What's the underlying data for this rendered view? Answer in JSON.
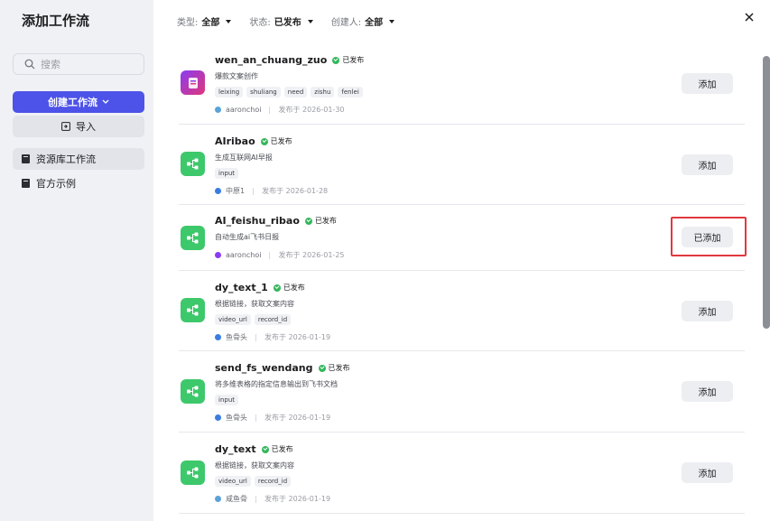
{
  "sidebar": {
    "title": "添加工作流",
    "search_placeholder": "搜索",
    "create_label": "创建工作流",
    "import_label": "导入",
    "nav": [
      {
        "label": "资源库工作流",
        "active": true
      },
      {
        "label": "官方示例",
        "active": false
      }
    ]
  },
  "filters": [
    {
      "label": "类型:",
      "value": "全部"
    },
    {
      "label": "状态:",
      "value": "已发布"
    },
    {
      "label": "创建人:",
      "value": "全部"
    }
  ],
  "status_label": "已发布",
  "workflows": [
    {
      "name": "wen_an_chuang_zuo",
      "desc": "爆款文案创作",
      "tags": [
        "leixing",
        "shuliang",
        "need",
        "zishu",
        "fenlei"
      ],
      "author": "aaronchoi",
      "date": "发布于 2026-01-30",
      "action": "添加",
      "icon": "app-icon"
    },
    {
      "name": "AIribao",
      "desc": "生成互联网AI早报",
      "tags": [
        "input"
      ],
      "author": "中原1",
      "date": "发布于 2026-01-28",
      "action": "添加",
      "icon": "workflow-icon"
    },
    {
      "name": "AI_feishu_ribao",
      "desc": "自动生成ai飞书日报",
      "tags": [],
      "author": "aaronchoi",
      "date": "发布于 2026-01-25",
      "action": "已添加",
      "icon": "workflow-icon"
    },
    {
      "name": "dy_text_1",
      "desc": "根据链接，获取文案内容",
      "tags": [
        "video_url",
        "record_id"
      ],
      "author": "鱼骨头",
      "date": "发布于 2026-01-19",
      "action": "添加",
      "icon": "workflow-icon"
    },
    {
      "name": "send_fs_wendang",
      "desc": "将多维表格的指定信息输出到飞书文档",
      "tags": [
        "input"
      ],
      "author": "鱼骨头",
      "date": "发布于 2026-01-19",
      "action": "添加",
      "icon": "workflow-icon"
    },
    {
      "name": "dy_text",
      "desc": "根据链接，获取文案内容",
      "tags": [
        "video_url",
        "record_id"
      ],
      "author": "咸鱼骨",
      "date": "发布于 2026-01-19",
      "action": "添加",
      "icon": "workflow-icon"
    }
  ],
  "colors": {
    "accent": "#4d53e8",
    "workflow_icon": "#3dc86b",
    "published": "#34b75c",
    "highlight": "#e0393e"
  }
}
